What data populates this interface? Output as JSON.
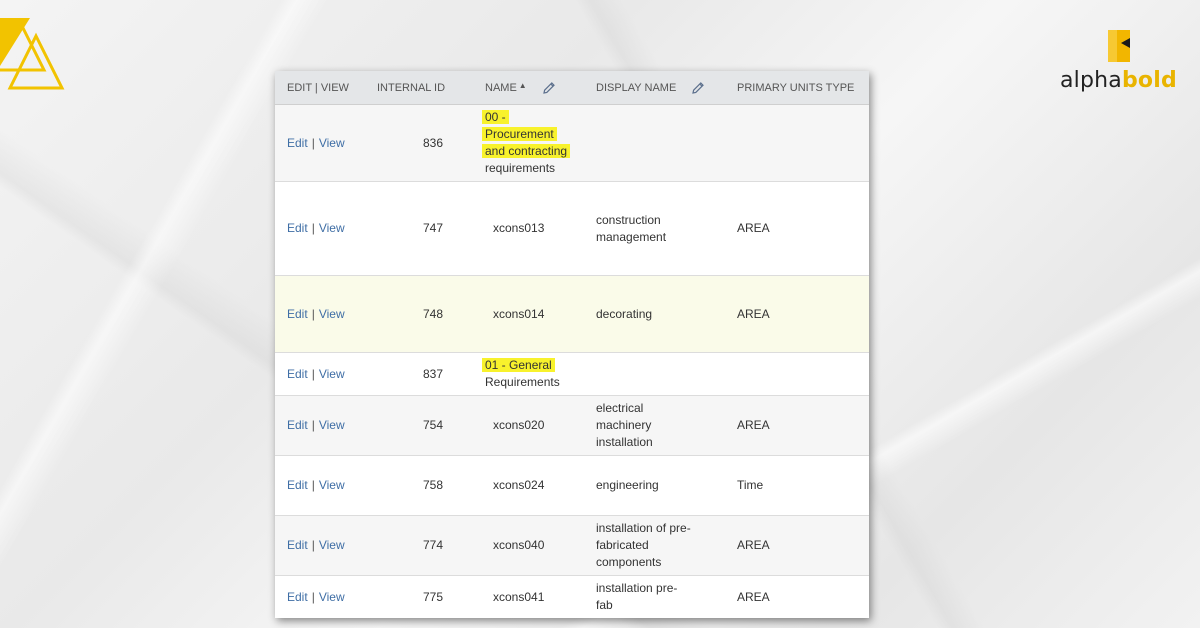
{
  "brand": {
    "word_left": "alpha",
    "word_right": "bold"
  },
  "table": {
    "headers": {
      "edit_view": "EDIT | VIEW",
      "internal_id": "INTERNAL ID",
      "name": "NAME",
      "display_name": "DISPLAY NAME",
      "primary_units_type": "PRIMARY UNITS TYPE"
    },
    "link_edit": "Edit",
    "link_sep": "|",
    "link_view": "View",
    "rows": [
      {
        "id": "836",
        "name_line1": "00 -",
        "name_line2": "Procurement",
        "name_line3": "and contracting",
        "name_line4": "requirements",
        "display": "",
        "units": ""
      },
      {
        "id": "747",
        "name": "xcons013",
        "display_line1": "construction",
        "display_line2": "management",
        "units": "AREA"
      },
      {
        "id": "748",
        "name": "xcons014",
        "display": "decorating",
        "units": "AREA"
      },
      {
        "id": "837",
        "name_line1": "01 - General",
        "name_line2": "Requirements",
        "display": "",
        "units": ""
      },
      {
        "id": "754",
        "name": "xcons020",
        "display_line1": "electrical",
        "display_line2": "machinery",
        "display_line3": "installation",
        "units": "AREA"
      },
      {
        "id": "758",
        "name": "xcons024",
        "display": "engineering",
        "units": "Time"
      },
      {
        "id": "774",
        "name": "xcons040",
        "display_line1": "installation of pre-",
        "display_line2": "fabricated",
        "display_line3": "components",
        "units": "AREA"
      },
      {
        "id": "775",
        "name": "xcons041",
        "display_line1": "installation pre-",
        "display_line2": "fab",
        "units": "AREA"
      }
    ]
  },
  "colors": {
    "link": "#3f6ea5",
    "highlight": "#f8f22c",
    "brand_gold": "#e9b400"
  }
}
